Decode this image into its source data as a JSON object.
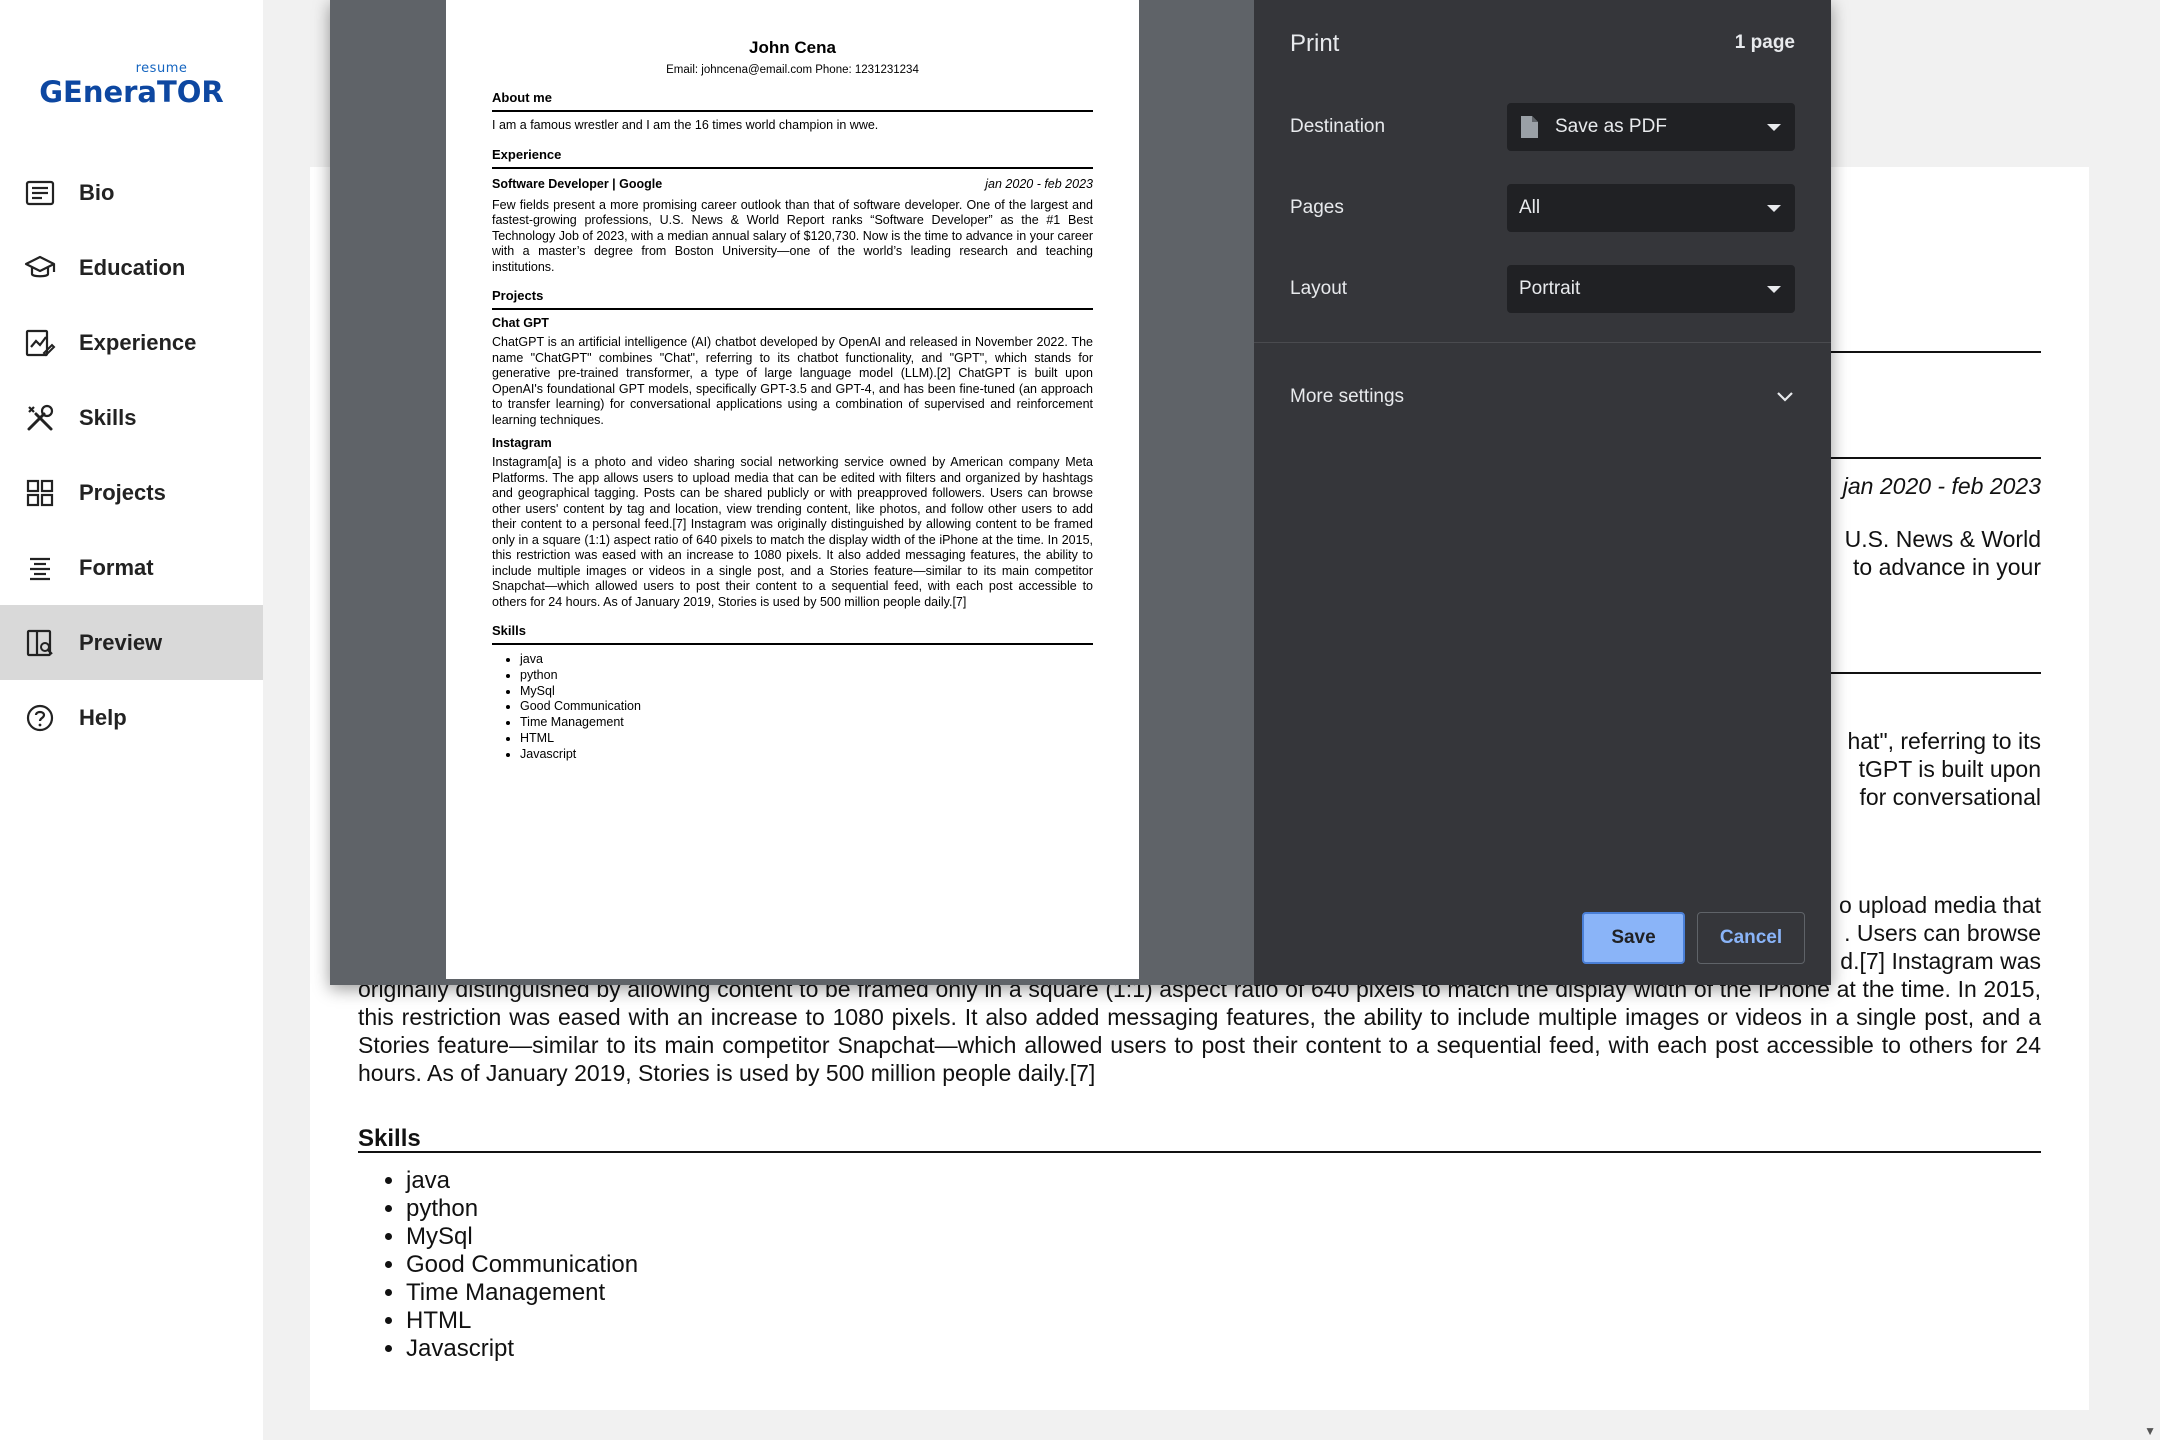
{
  "app": {
    "logo_small": "resume",
    "logo_big": "GEneraTOR"
  },
  "sidebar": {
    "items": [
      {
        "label": "Bio",
        "icon": "bio-icon"
      },
      {
        "label": "Education",
        "icon": "education-icon"
      },
      {
        "label": "Experience",
        "icon": "experience-icon"
      },
      {
        "label": "Skills",
        "icon": "skills-icon"
      },
      {
        "label": "Projects",
        "icon": "projects-icon"
      },
      {
        "label": "Format",
        "icon": "format-icon"
      },
      {
        "label": "Preview",
        "icon": "preview-icon",
        "active": true
      },
      {
        "label": "Help",
        "icon": "help-icon"
      }
    ]
  },
  "background_resume": {
    "date_fragment": "jan 2020 - feb 2023",
    "exp_fragment_1": "U.S. News & World",
    "exp_fragment_2": "to advance in your",
    "proj_fragment_1": "hat\", referring to its",
    "proj_fragment_2": "tGPT is built upon",
    "proj_fragment_3": "for conversational",
    "insta_fragment_1": "o upload media that",
    "insta_fragment_2": ". Users can browse",
    "insta_fragment_3": "d.[7] Instagram was",
    "insta_paragraph": "originally distinguished by allowing content to be framed only in a square (1:1) aspect ratio of 640 pixels to match the display width of the iPhone at the time. In 2015, this restriction was eased with an increase to 1080 pixels. It also added messaging features, the ability to include multiple images or videos in a single post, and a Stories feature—similar to its main competitor Snapchat—which allowed users to post their content to a sequential feed, with each post accessible to others for 24 hours. As of January 2019, Stories is used by 500 million people daily.[7]",
    "skills_heading": "Skills",
    "skills": [
      "java",
      "python",
      "MySql",
      "Good Communication",
      "Time Management",
      "HTML",
      "Javascript"
    ]
  },
  "resume": {
    "name": "John Cena",
    "contact": "Email:  johncena@email.com  Phone:  1231231234",
    "about_heading": "About me",
    "about_text": "I am a famous wrestler and I am the 16 times world champion in wwe.",
    "experience_heading": "Experience",
    "job_title": "Software Developer | Google",
    "job_dates": "jan 2020 - feb 2023",
    "job_text": "Few fields present a more promising career outlook than that of software developer. One of the largest and fastest-growing professions, U.S. News & World Report ranks “Software Developer” as the #1 Best Technology Job of 2023, with a median annual salary of $120,730. Now is the time to advance in your career with a master’s degree from Boston University—one of the world’s leading research and teaching institutions.",
    "projects_heading": "Projects",
    "project1_title": "Chat GPT",
    "project1_text": "ChatGPT is an artificial intelligence (AI) chatbot developed by OpenAI and released in November 2022. The name \"ChatGPT\" combines \"Chat\", referring to its chatbot functionality, and \"GPT\", which stands for generative pre-trained transformer, a type of large language model (LLM).[2] ChatGPT is built upon OpenAI's foundational GPT models, specifically GPT-3.5 and GPT-4, and has been fine-tuned (an approach to transfer learning) for conversational applications using a combination of supervised and reinforcement learning techniques.",
    "project2_title": "Instagram",
    "project2_text": "Instagram[a] is a photo and video sharing social networking service owned by American company Meta Platforms. The app allows users to upload media that can be edited with filters and organized by hashtags and geographical tagging. Posts can be shared publicly or with preapproved followers. Users can browse other users' content by tag and location, view trending content, like photos, and follow other users to add their content to a personal feed.[7] Instagram was originally distinguished by allowing content to be framed only in a square (1:1) aspect ratio of 640 pixels to match the display width of the iPhone at the time. In 2015, this restriction was eased with an increase to 1080 pixels. It also added messaging features, the ability to include multiple images or videos in a single post, and a Stories feature—similar to its main competitor Snapchat—which allowed users to post their content to a sequential feed, with each post accessible to others for 24 hours. As of January 2019, Stories is used by 500 million people daily.[7]",
    "skills_heading": "Skills",
    "skills": [
      "java",
      "python",
      "MySql",
      "Good Communication",
      "Time Management",
      "HTML",
      "Javascript"
    ]
  },
  "print_dialog": {
    "title": "Print",
    "page_count": "1 page",
    "destination_label": "Destination",
    "destination_value": "Save as PDF",
    "pages_label": "Pages",
    "pages_value": "All",
    "layout_label": "Layout",
    "layout_value": "Portrait",
    "more_settings_label": "More settings",
    "save_label": "Save",
    "cancel_label": "Cancel"
  }
}
